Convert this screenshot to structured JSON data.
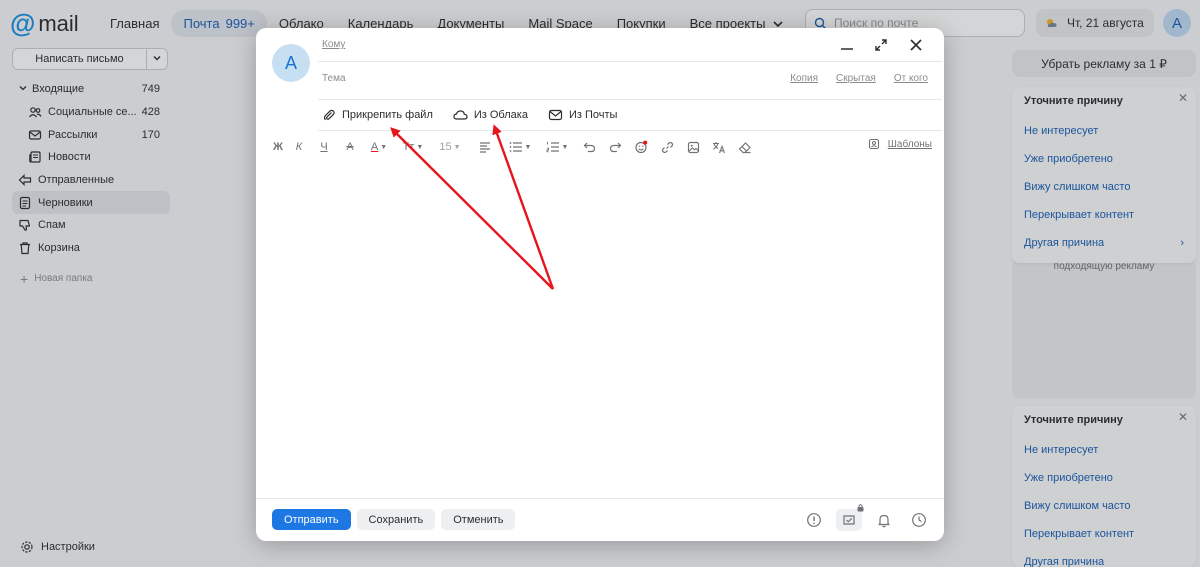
{
  "brand": {
    "logo_text": "mail"
  },
  "topnav": {
    "items": [
      {
        "label": "Главная"
      },
      {
        "label": "Почта",
        "count": "999+"
      },
      {
        "label": "Облако"
      },
      {
        "label": "Календарь"
      },
      {
        "label": "Документы"
      },
      {
        "label": "Mail Space"
      },
      {
        "label": "Покупки"
      },
      {
        "label": "Все проекты"
      }
    ],
    "search_placeholder": "Поиск по почте",
    "date": "Чт, 21 августа",
    "avatar_letter": "A"
  },
  "sidebar": {
    "compose_label": "Написать письмо",
    "folders": [
      {
        "name": "Входящие",
        "count": "749"
      },
      {
        "name": "Социальные се...",
        "count": "428"
      },
      {
        "name": "Рассылки",
        "count": "170"
      },
      {
        "name": "Новости",
        "count": ""
      },
      {
        "name": "Отправленные",
        "count": ""
      },
      {
        "name": "Черновики",
        "count": ""
      },
      {
        "name": "Спам",
        "count": ""
      },
      {
        "name": "Корзина",
        "count": ""
      }
    ],
    "new_folder": "Новая папка",
    "settings": "Настройки"
  },
  "ads": {
    "remove_ads": "Убрать рекламу за 1 ₽",
    "reason_title": "Уточните причину",
    "reasons": [
      "Не интересует",
      "Уже приобретено",
      "Вижу слишком часто",
      "Перекрывает контент",
      "Другая причина"
    ],
    "footer_text": "подходящую рекламу"
  },
  "compose": {
    "avatar_letter": "A",
    "to_label": "Кому",
    "subject_label": "Тема",
    "links": [
      "Копия",
      "Скрытая",
      "От кого"
    ],
    "attach": [
      {
        "label": "Прикрепить файл",
        "icon": "paperclip-icon"
      },
      {
        "label": "Из Облака",
        "icon": "cloud-icon"
      },
      {
        "label": "Из Почты",
        "icon": "envelope-icon"
      }
    ],
    "format": {
      "bold": "Ж",
      "italic": "К",
      "underline": "Ч",
      "strike": "А",
      "color": "А",
      "size_glyph": "Тт",
      "font_size": "15"
    },
    "templates_label": "Шаблоны",
    "send": "Отправить",
    "save": "Сохранить",
    "cancel": "Отменить"
  },
  "colors": {
    "accent": "#1d78e4",
    "arrow": "#e8141b",
    "link": "#1a5fb4"
  }
}
